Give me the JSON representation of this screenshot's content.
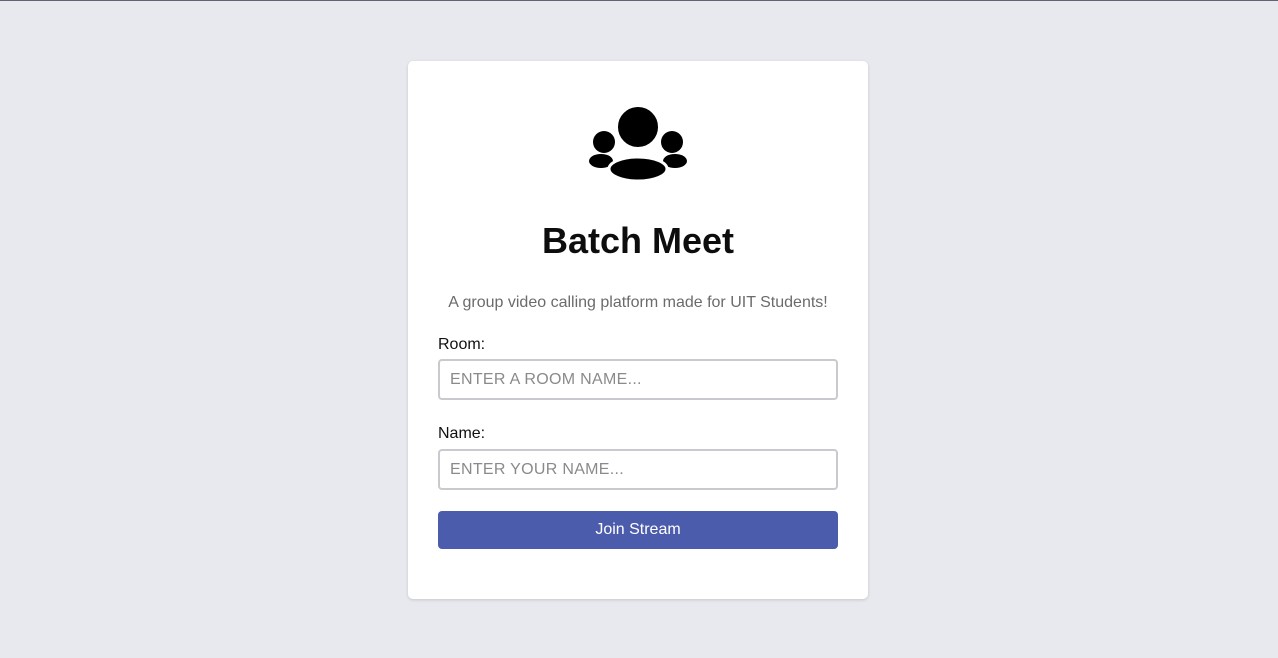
{
  "app": {
    "icon": "users-group-icon",
    "title": "Batch Meet",
    "subtitle": "A group video calling platform made for UIT Students!"
  },
  "form": {
    "room_label": "Room:",
    "room_placeholder": "ENTER A ROOM NAME...",
    "room_value": "",
    "name_label": "Name:",
    "name_placeholder": "ENTER YOUR NAME...",
    "name_value": "",
    "submit_label": "Join Stream"
  },
  "colors": {
    "background": "#e8e9ee",
    "card": "#ffffff",
    "accent": "#4b5cad"
  }
}
